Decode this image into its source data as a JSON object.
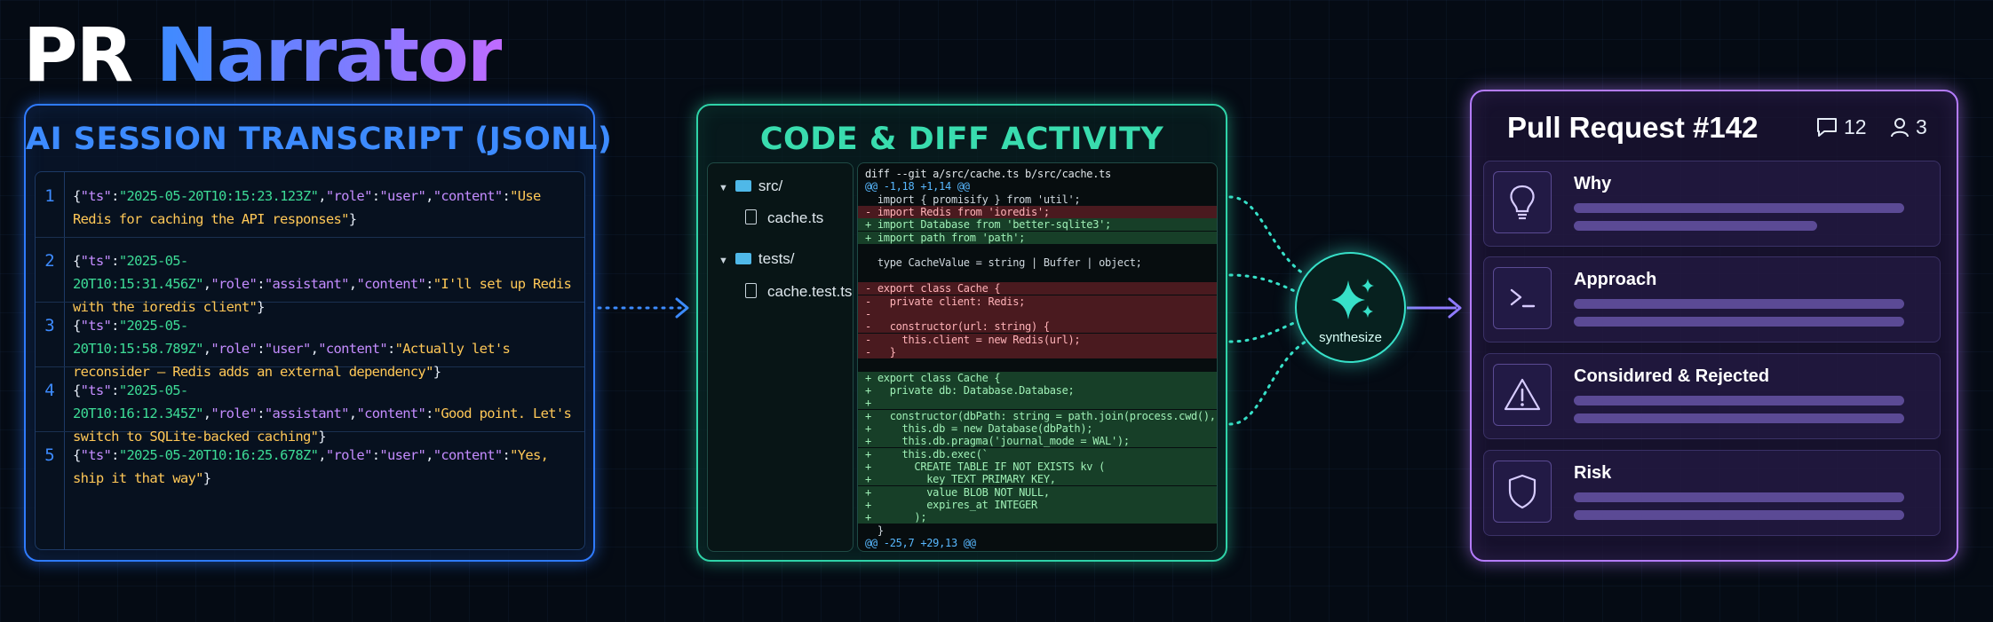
{
  "title": {
    "part1": "PR",
    "part2": "Narrator"
  },
  "transcript": {
    "title": "AI SESSION TRANSCRIPT (JSONL)",
    "rows": [
      {
        "num": "1",
        "ts": "2025-05-20T10:15:23.123Z",
        "role": "user",
        "content": "Use Redis for caching the API responses"
      },
      {
        "num": "2",
        "ts": "2025-05-20T10:15:31.456Z",
        "role": "assistant",
        "content": "I'll set up Redis with the ioredis client"
      },
      {
        "num": "3",
        "ts": "2025-05-20T10:15:58.789Z",
        "role": "user",
        "content": "Actually let's reconsider — Redis adds an external dependency"
      },
      {
        "num": "4",
        "ts": "2025-05-20T10:16:12.345Z",
        "role": "assistant",
        "content": "Good point. Let's switch to SQLite-backed caching"
      },
      {
        "num": "5",
        "ts": "2025-05-20T10:16:25.678Z",
        "role": "user",
        "content": "Yes, ship it that way"
      }
    ]
  },
  "code": {
    "title": "CODE & DIFF ACTIVITY",
    "tree": [
      {
        "type": "folder",
        "name": "src/"
      },
      {
        "type": "file",
        "name": "cache.ts"
      },
      {
        "type": "folder",
        "name": "tests/"
      },
      {
        "type": "file",
        "name": "cache.test.ts"
      }
    ],
    "diff": [
      {
        "kind": "head",
        "text": "diff --git a/src/cache.ts b/src/cache.ts"
      },
      {
        "kind": "hunk",
        "text": "@@ -1,18 +1,14 @@"
      },
      {
        "kind": "ctx",
        "text": "  import { promisify } from 'util';"
      },
      {
        "kind": "del",
        "text": "- import Redis from 'ioredis';"
      },
      {
        "kind": "add",
        "text": "+ import Database from 'better-sqlite3';"
      },
      {
        "kind": "add",
        "text": "+ import path from 'path';"
      },
      {
        "kind": "ctx",
        "text": ""
      },
      {
        "kind": "ctx",
        "text": "  type CacheValue = string | Buffer | object;"
      },
      {
        "kind": "ctx",
        "text": ""
      },
      {
        "kind": "del",
        "text": "- export class Cache {"
      },
      {
        "kind": "del",
        "text": "-   private client: Redis;"
      },
      {
        "kind": "del",
        "text": "-"
      },
      {
        "kind": "del",
        "text": "-   constructor(url: string) {"
      },
      {
        "kind": "del",
        "text": "-     this.client = new Redis(url);"
      },
      {
        "kind": "del",
        "text": "-   }"
      },
      {
        "kind": "ctx",
        "text": ""
      },
      {
        "kind": "add",
        "text": "+ export class Cache {"
      },
      {
        "kind": "add",
        "text": "+   private db: Database.Database;"
      },
      {
        "kind": "add",
        "text": "+"
      },
      {
        "kind": "add",
        "text": "+   constructor(dbPath: string = path.join(process.cwd(), 'cache.db')) {"
      },
      {
        "kind": "add",
        "text": "+     this.db = new Database(dbPath);"
      },
      {
        "kind": "add",
        "text": "+     this.db.pragma('journal_mode = WAL');"
      },
      {
        "kind": "add",
        "text": "+     this.db.exec(`"
      },
      {
        "kind": "add",
        "text": "+       CREATE TABLE IF NOT EXISTS kv ("
      },
      {
        "kind": "add",
        "text": "+         key TEXT PRIMARY KEY,"
      },
      {
        "kind": "add",
        "text": "+         value BLOB NOT NULL,"
      },
      {
        "kind": "add",
        "text": "+         expires_at INTEGER"
      },
      {
        "kind": "add",
        "text": "+       );"
      },
      {
        "kind": "ctx",
        "text": "  }"
      },
      {
        "kind": "hunk",
        "text": "@@ -25,7 +29,13 @@"
      }
    ]
  },
  "synthesize_label": "synthesize",
  "pr": {
    "title": "Pull Request #142",
    "comments": "12",
    "reviewers": "3",
    "sections": [
      {
        "label": "Why",
        "icon": "lightbulb-icon"
      },
      {
        "label": "Approach",
        "icon": "terminal-icon"
      },
      {
        "label": "Considиred & Rejected",
        "icon": "warning-icon"
      },
      {
        "label": "Risk",
        "icon": "shield-icon"
      }
    ]
  },
  "colors": {
    "transcript_accent": "#2f7bff",
    "code_accent": "#2fd3a8",
    "pr_accent": "#b57cff",
    "synth_accent": "#37e0c8"
  }
}
